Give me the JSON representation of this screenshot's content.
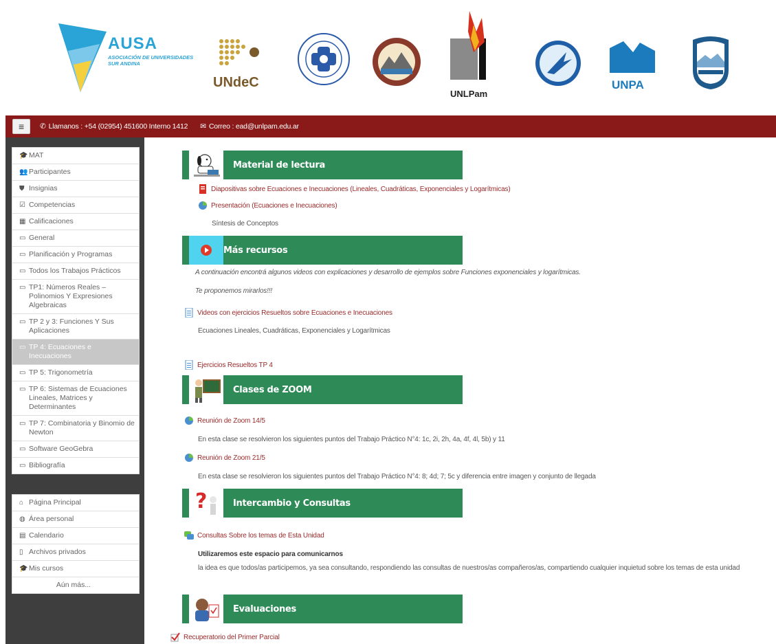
{
  "banner": {
    "ausa_name": "AUSA",
    "ausa_subtitle": "ASOCIACIÓN DE UNIVERSIDADES SUR ANDINA",
    "undec_name": "UNdeC",
    "unlpam_name": "UNLPam",
    "unpa_name": "UNPA"
  },
  "topbar": {
    "menu_icon": "≡",
    "phone_label": "Llamanos : +54 (02954) 451600 Interno 1412",
    "email_label": "Correo : ead@unlpam.edu.ar"
  },
  "sidebar": {
    "course_items": [
      {
        "icon": "graduation-cap-icon",
        "glyph": "🎓",
        "label": "MAT"
      },
      {
        "icon": "users-icon",
        "glyph": "👥",
        "label": "Participantes"
      },
      {
        "icon": "shield-icon",
        "glyph": "⛊",
        "label": "Insignias"
      },
      {
        "icon": "checkbox-icon",
        "glyph": "☑",
        "label": "Competencias"
      },
      {
        "icon": "table-icon",
        "glyph": "▦",
        "label": "Calificaciones"
      },
      {
        "icon": "folder-icon",
        "glyph": "▭",
        "label": "General"
      },
      {
        "icon": "folder-icon",
        "glyph": "▭",
        "label": "Planificación y Programas"
      },
      {
        "icon": "folder-icon",
        "glyph": "▭",
        "label": "Todos los Trabajos Prácticos"
      },
      {
        "icon": "folder-icon",
        "glyph": "▭",
        "label": "TP1: Números Reales – Polinomios Y Expresiones Algebraicas"
      },
      {
        "icon": "folder-icon",
        "glyph": "▭",
        "label": "TP 2 y 3: Funciones Y Sus Aplicaciones"
      },
      {
        "icon": "folder-icon",
        "glyph": "▭",
        "label": "TP 4: Ecuaciones e Inecuaciones"
      },
      {
        "icon": "folder-icon",
        "glyph": "▭",
        "label": "TP 5: Trigonometría"
      },
      {
        "icon": "folder-icon",
        "glyph": "▭",
        "label": "TP 6: Sistemas de Ecuaciones Lineales, Matrices y Determinantes"
      },
      {
        "icon": "folder-icon",
        "glyph": "▭",
        "label": "TP 7: Combinatoria y Binomio de Newton"
      },
      {
        "icon": "folder-icon",
        "glyph": "▭",
        "label": "Software GeoGebra"
      },
      {
        "icon": "folder-icon",
        "glyph": "▭",
        "label": "Bibliografía"
      }
    ],
    "site_items": [
      {
        "icon": "home-icon",
        "glyph": "⌂",
        "label": "Página Principal"
      },
      {
        "icon": "dashboard-icon",
        "glyph": "◍",
        "label": "Área personal"
      },
      {
        "icon": "calendar-icon",
        "glyph": "▤",
        "label": "Calendario"
      },
      {
        "icon": "file-icon",
        "glyph": "▯",
        "label": "Archivos privados"
      },
      {
        "icon": "graduation-cap-icon",
        "glyph": "🎓",
        "label": "Mis cursos"
      },
      {
        "icon": "",
        "glyph": "",
        "label": "Aún más..."
      }
    ]
  },
  "main": {
    "sections": {
      "lectura": "Material de lectura",
      "recursos": "Más recursos",
      "zoom": "Clases de ZOOM",
      "consultas": "Intercambio y Consultas",
      "evaluaciones": "Evaluaciones"
    },
    "items": {
      "diapositivas": "Diapositivas sobre Ecuaciones e Inecuaciones (Lineales, Cuadráticas, Exponenciales y Logarítmicas)",
      "presentacion": "Presentación (Ecuaciones e Inecuaciones)",
      "sintesis": "Síntesis de Conceptos",
      "recursos_intro": "A continuación encontrá algunos videos con explicaciones y desarrollo de ejemplos sobre Funciones exponenciales y logarítmicas.",
      "recursos_invite": "Te proponemos mirarlos!!!",
      "videos_link": "Videos con ejercicios Resueltos sobre Ecuaciones e Inecuaciones",
      "videos_desc": "Ecuaciones Lineales, Cuadráticas, Exponenciales y Logarítmicas",
      "ejercicios_link": "Ejercicios Resueltos TP 4",
      "zoom1_link": "Reunión de Zoom 14/5",
      "zoom1_desc": "En esta clase se resolvieron los siguientes puntos del Trabajo Práctico N°4: 1c, 2i, 2h, 4a, 4f, 4l, 5b) y 11",
      "zoom2_link": "Reunión de Zoom 21/5",
      "zoom2_desc": "En esta clase se resolvieron los siguientes puntos del Trabajo Práctico N°4: 8; 4d; 7; 5c y diferencia entre imagen y conjunto de llegada",
      "foro_link": "Consultas Sobre los temas de Esta Unidad",
      "foro_title": "Utilizaremos este espacio para comunicarnos",
      "foro_desc": "la idea es que todos/as participemos,  ya sea consultando, respondiendo las consultas de nuestros/as compañeros/as, compartiendo cualquier inquietud sobre los temas de esta unidad",
      "recuperatorio_link": "Recuperatorio del Primer Parcial"
    }
  }
}
